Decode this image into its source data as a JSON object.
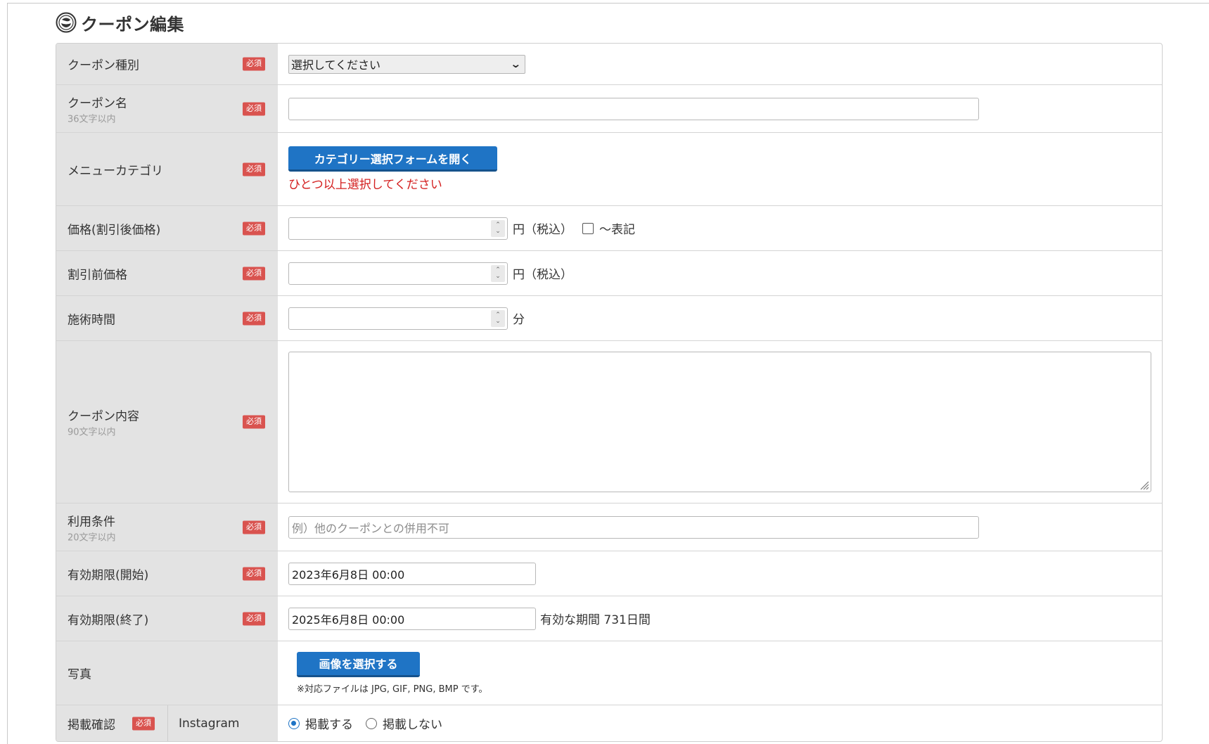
{
  "page": {
    "title": "クーポン編集",
    "logo_icon": "salon-logo-icon"
  },
  "required_badge": "必須",
  "fields": {
    "coupon_type": {
      "label": "クーポン種別",
      "selected": "選択してください"
    },
    "coupon_name": {
      "label": "クーポン名",
      "sublabel": "36文字以内",
      "value": ""
    },
    "menu_category": {
      "label": "メニューカテゴリ",
      "button": "カテゴリー選択フォームを開く",
      "error": "ひとつ以上選択してください"
    },
    "price": {
      "label": "価格(割引後価格)",
      "value": "",
      "unit": "円（税込）",
      "checkbox_label": "〜表記",
      "checked": false
    },
    "original_price": {
      "label": "割引前価格",
      "value": "",
      "unit": "円（税込）"
    },
    "duration": {
      "label": "施術時間",
      "value": "",
      "unit": "分"
    },
    "content": {
      "label": "クーポン内容",
      "sublabel": "90文字以内",
      "value": ""
    },
    "conditions": {
      "label": "利用条件",
      "sublabel": "20文字以内",
      "placeholder": "例）他のクーポンとの併用不可"
    },
    "valid_start": {
      "label": "有効期限(開始)",
      "value": "2023年6月8日 00:00"
    },
    "valid_end": {
      "label": "有効期限(終了)",
      "value": "2025年6月8日 00:00",
      "period_text": "有効な期間 731日間"
    },
    "photo": {
      "label": "写真",
      "button": "画像を選択する",
      "note": "※対応ファイルは JPG, GIF, PNG, BMP です。"
    },
    "publish": {
      "label": "掲載確認",
      "channel": "Instagram",
      "options": [
        "掲載する",
        "掲載しない"
      ],
      "selected_index": 0
    }
  },
  "colors": {
    "accent": "#1f74c5",
    "required": "#d9534f",
    "error": "#d42020",
    "label_bg": "#e3e3e3"
  }
}
